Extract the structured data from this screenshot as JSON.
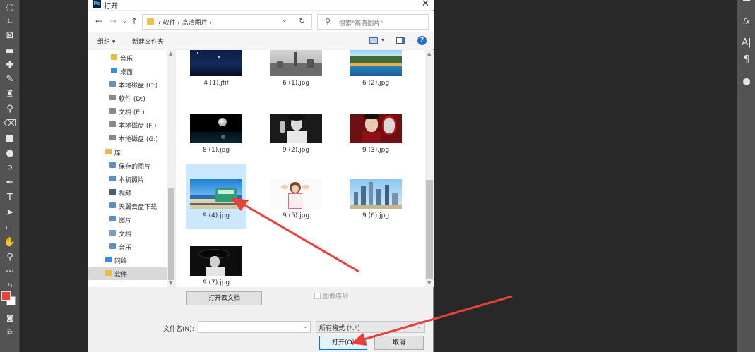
{
  "dialog": {
    "title": "打开",
    "close": "✕",
    "breadcrumb": "›  软件  ›  高清图片  ›",
    "search_placeholder": "搜索\"高清图片\"",
    "organize": "组织 ▾",
    "new_folder": "新建文件夹",
    "help": "?"
  },
  "nav_tree": [
    {
      "label": "音乐",
      "icon": "music-icon",
      "color": "#e9b94a"
    },
    {
      "label": "桌面",
      "icon": "desktop-icon",
      "color": "#3a8ed8"
    },
    {
      "label": "本地磁盘 (C:)",
      "icon": "drive-icon",
      "color": "#6d8fb5"
    },
    {
      "label": "软件 (D:)",
      "icon": "drive-icon",
      "color": "#888888"
    },
    {
      "label": "文档 (E:)",
      "icon": "drive-icon",
      "color": "#888888"
    },
    {
      "label": "本地磁盘 (F:)",
      "icon": "drive-icon",
      "color": "#888888"
    },
    {
      "label": "本地磁盘 (G:)",
      "icon": "drive-icon",
      "color": "#888888"
    },
    {
      "label": "库",
      "icon": "library-icon",
      "color": "#e9b94a"
    },
    {
      "label": "保存的图片",
      "icon": "pictures-icon",
      "color": "#5b8fc8"
    },
    {
      "label": "本机照片",
      "icon": "pictures-icon",
      "color": "#5b8fc8"
    },
    {
      "label": "视频",
      "icon": "video-icon",
      "color": "#4b5b70"
    },
    {
      "label": "天翼云盘下载",
      "icon": "folder-icon",
      "color": "#5b8fc8"
    },
    {
      "label": "图片",
      "icon": "pictures-icon",
      "color": "#5b8fc8"
    },
    {
      "label": "文档",
      "icon": "documents-icon",
      "color": "#7a9ccc"
    },
    {
      "label": "音乐",
      "icon": "music-icon",
      "color": "#5b8fc8"
    },
    {
      "label": "网络",
      "icon": "network-icon",
      "color": "#3a8ed8"
    },
    {
      "label": "软件",
      "icon": "folder-icon",
      "color": "#e9b94a"
    }
  ],
  "files": [
    {
      "name": "4 (1).jfif",
      "thumb": "dark-blue-sky"
    },
    {
      "name": "6 (1).jpg",
      "thumb": "city-gray"
    },
    {
      "name": "6 (2).jpg",
      "thumb": "lake-mountains"
    },
    {
      "name": "8 (1).jpg",
      "thumb": "moon-night"
    },
    {
      "name": "9 (2).jpg",
      "thumb": "bw-portrait"
    },
    {
      "name": "9 (3).jpg",
      "thumb": "opera-mask"
    },
    {
      "name": "9 (4).jpg",
      "thumb": "tram-sea"
    },
    {
      "name": "9 (5).jpg",
      "thumb": "girl-white"
    },
    {
      "name": "9 (6).jpg",
      "thumb": "skyline-blue"
    },
    {
      "name": "9 (7).jpg",
      "thumb": "bw-hat"
    }
  ],
  "selected_file_index": 6,
  "bottom": {
    "cloud_button": "打开云文档",
    "image_sequence": "图像序列",
    "filename_label": "文件名(N):",
    "filename_value": "",
    "filetype": "所有格式 (*.*)",
    "open_button": "打开(O)",
    "cancel_button": "取消"
  },
  "colors": {
    "foreground_swatch": "#e8413a",
    "background_swatch": "#ffffff",
    "annotation_arrow": "#e8413a",
    "selection": "#cce8ff"
  }
}
